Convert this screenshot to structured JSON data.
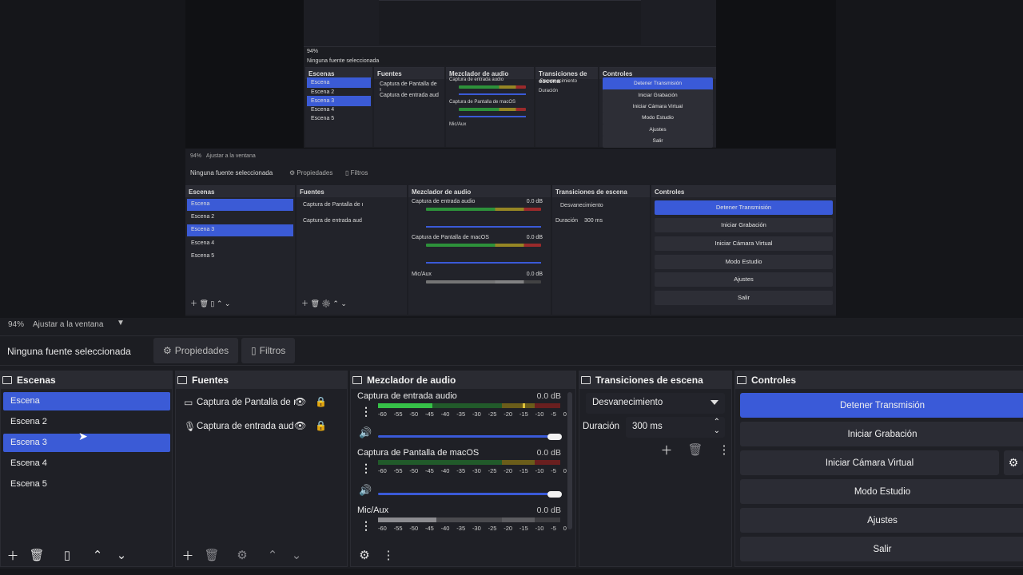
{
  "zoombar": {
    "zoom": "94%",
    "fit": "Ajustar a la ventana"
  },
  "srcbar": {
    "no_source": "Ninguna fuente seleccionada",
    "properties": "Propiedades",
    "filters": "Filtros"
  },
  "scenes": {
    "title": "Escenas",
    "items": [
      {
        "label": "Escena",
        "selected": true
      },
      {
        "label": "Escena 2",
        "selected": false
      },
      {
        "label": "Escena 3",
        "selected": true
      },
      {
        "label": "Escena 4",
        "selected": false
      },
      {
        "label": "Escena 5",
        "selected": false
      }
    ]
  },
  "sources": {
    "title": "Fuentes",
    "items": [
      {
        "label": "Captura de Pantalla de ı",
        "icon": "monitor-icon"
      },
      {
        "label": "Captura de entrada aud",
        "icon": "microphone-icon"
      }
    ]
  },
  "mixer": {
    "title": "Mezclador de audio",
    "ticks": [
      "-60",
      "-55",
      "-50",
      "-45",
      "-40",
      "-35",
      "-30",
      "-25",
      "-20",
      "-15",
      "-10",
      "-5",
      "0"
    ],
    "channels": [
      {
        "name": "Captura de entrada audio",
        "db": "0.0 dB",
        "level": 0.3
      },
      {
        "name": "Captura de Pantalla de macOS",
        "db": "0.0 dB",
        "level": 0.0
      },
      {
        "name": "Mic/Aux",
        "db": "0.0 dB",
        "level": 0.0
      }
    ]
  },
  "transitions": {
    "title": "Transiciones de escena",
    "selected": "Desvanecimiento",
    "duration_label": "Duración",
    "duration_value": "300 ms"
  },
  "controls": {
    "title": "Controles",
    "buttons": [
      {
        "label": "Detener Transmisión",
        "primary": true
      },
      {
        "label": "Iniciar Grabación",
        "primary": false
      },
      {
        "label": "Iniciar Cámara Virtual",
        "primary": false
      },
      {
        "label": "Modo Estudio",
        "primary": false
      },
      {
        "label": "Ajustes",
        "primary": false
      },
      {
        "label": "Salir",
        "primary": false
      }
    ]
  },
  "colors": {
    "accent": "#3a5ad8",
    "background": "#1c1d22",
    "panel": "#1f2026"
  }
}
